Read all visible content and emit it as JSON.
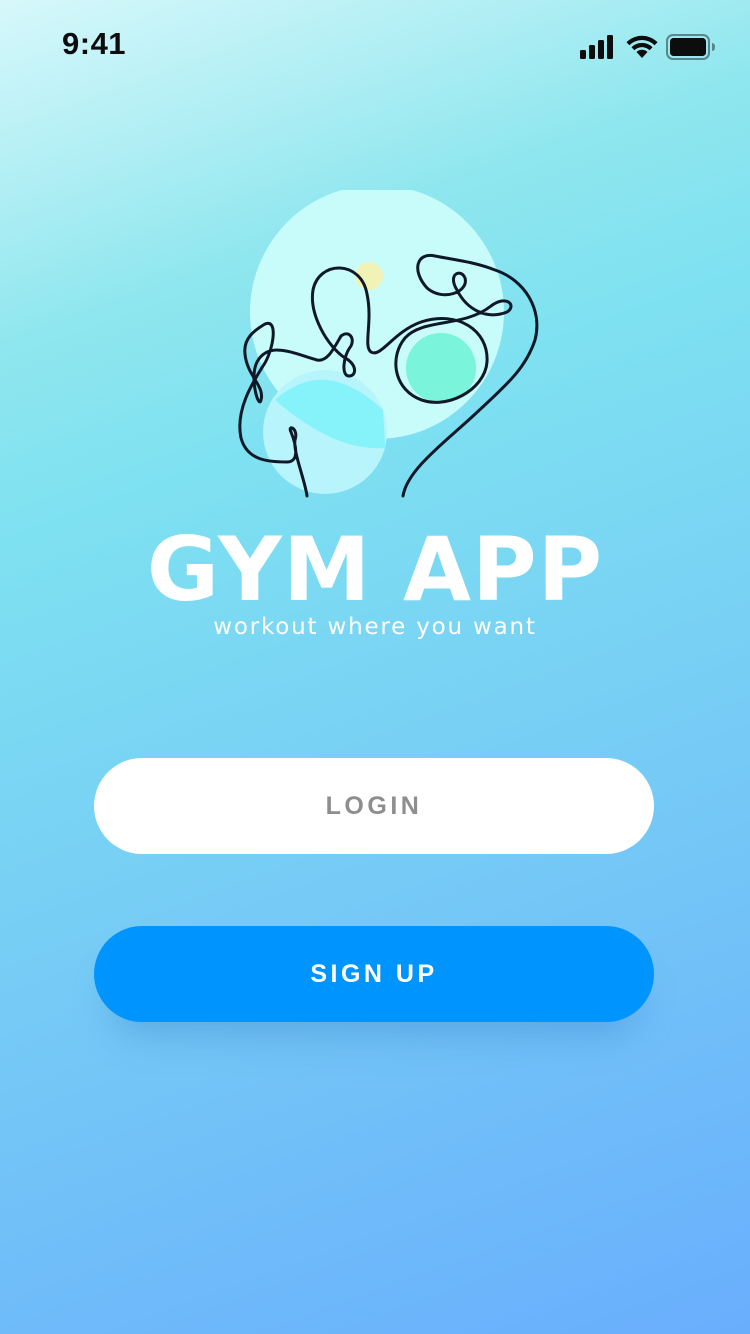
{
  "status_bar": {
    "time": "9:41",
    "icons": [
      "cellular-signal-icon",
      "wifi-icon",
      "battery-icon"
    ]
  },
  "app": {
    "title": "GYM APP",
    "tagline": "workout where you want",
    "logo": "abstract-line-art-illustration"
  },
  "buttons": {
    "login_label": "LOGIN",
    "signup_label": "SIGN UP"
  },
  "colors": {
    "primary": "#0094fe",
    "login_bg": "#ffffff",
    "login_text": "#8e8e8e",
    "gradient_top": "#d7f8fb",
    "gradient_bottom": "#69aefd"
  }
}
